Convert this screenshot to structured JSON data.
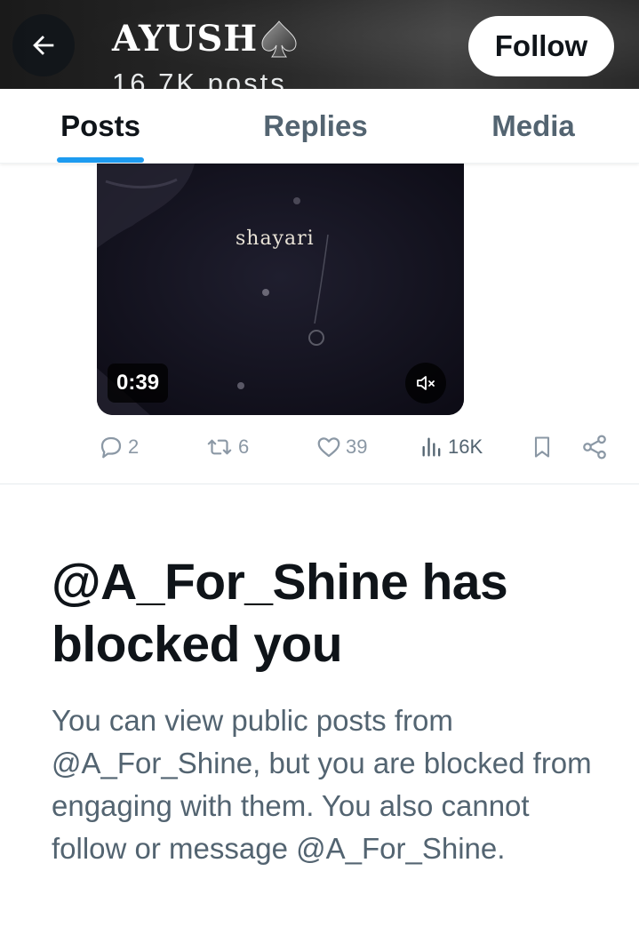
{
  "header": {
    "back_label": "Back",
    "profile_name": "AYUSH",
    "post_count": "16.7K posts",
    "follow_label": "Follow"
  },
  "tabs": [
    {
      "label": "Posts",
      "active": true
    },
    {
      "label": "Replies",
      "active": false
    },
    {
      "label": "Media",
      "active": false
    }
  ],
  "media": {
    "caption": "shayari",
    "duration": "0:39",
    "muted": true
  },
  "actions": {
    "replies": "2",
    "reposts": "6",
    "likes": "39",
    "views": "16K"
  },
  "notice": {
    "title": "@A_For_Shine has blocked you",
    "description": "You can view public posts from @A_For_Shine, but you are blocked from engaging with them. You also cannot follow or message @A_For_Shine."
  },
  "colors": {
    "accent": "#1d9bf0",
    "text_primary": "#0f1419",
    "text_secondary": "#536471"
  },
  "icons": [
    "arrow-left-icon",
    "spade-icon",
    "mute-icon",
    "reply-icon",
    "repost-icon",
    "like-icon",
    "views-icon",
    "bookmark-icon",
    "share-icon"
  ]
}
